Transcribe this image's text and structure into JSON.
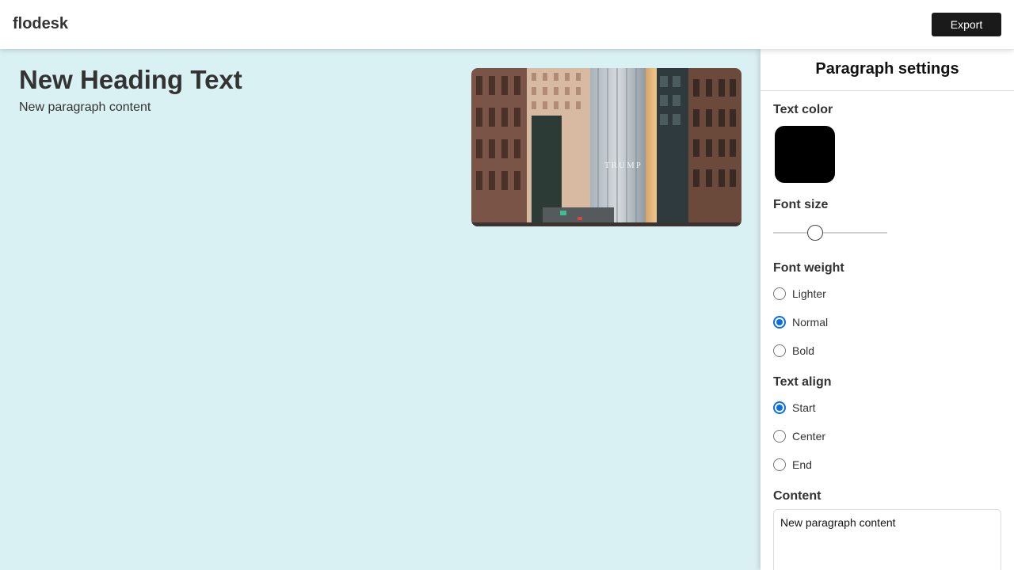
{
  "app": {
    "logo": "flodesk",
    "export_label": "Export"
  },
  "canvas": {
    "background_color": "#daf1f4",
    "heading": "New Heading Text",
    "paragraph": "New paragraph content",
    "photo": {
      "sign_text": "TRUMP"
    }
  },
  "panel": {
    "title": "Paragraph settings",
    "text_color": {
      "label": "Text color",
      "value": "#000000"
    },
    "font_size": {
      "label": "Font size",
      "level": 0.35
    },
    "font_weight": {
      "label": "Font weight",
      "options": [
        "Lighter",
        "Normal",
        "Bold"
      ],
      "selected": "Normal"
    },
    "text_align": {
      "label": "Text align",
      "options": [
        "Start",
        "Center",
        "End"
      ],
      "selected": "Start"
    },
    "content": {
      "label": "Content",
      "value": "New paragraph content"
    }
  },
  "colors": {
    "accent": "#0b6ee6",
    "button": "#1a1a1a"
  }
}
